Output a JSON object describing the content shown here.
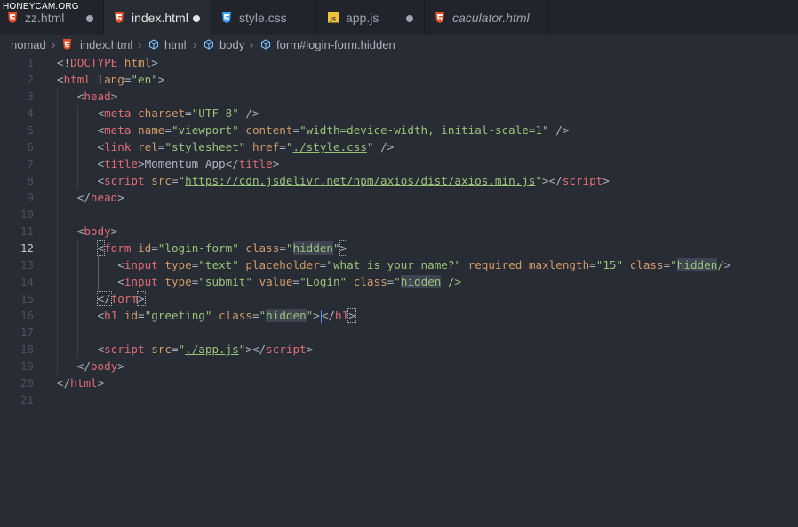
{
  "watermark": "HONEYCAM.ORG",
  "tabs": [
    {
      "label": "zz.html",
      "icon": "html5-icon",
      "modified": true
    },
    {
      "label": "index.html",
      "icon": "html5-icon",
      "modified": true,
      "active": true
    },
    {
      "label": "style.css",
      "icon": "css3-icon",
      "modified": false
    },
    {
      "label": "app.js",
      "icon": "js-icon",
      "modified": true
    },
    {
      "label": "caculator.html",
      "icon": "html5-icon",
      "modified": false,
      "italic": true
    }
  ],
  "breadcrumb": [
    "nomad",
    "index.html",
    "html",
    "body",
    "form#login-form.hidden"
  ],
  "cursor_line": 12,
  "lines": [
    "1",
    "2",
    "3",
    "4",
    "5",
    "6",
    "7",
    "8",
    "9",
    "10",
    "11",
    "12",
    "13",
    "14",
    "15",
    "16",
    "17",
    "18",
    "19",
    "20",
    "21"
  ],
  "colors": {
    "tag": "#e06c75",
    "attr": "#d19a66",
    "string": "#98c379",
    "text": "#abb2bf",
    "background": "#282c34",
    "tab_bar": "#21252b"
  }
}
